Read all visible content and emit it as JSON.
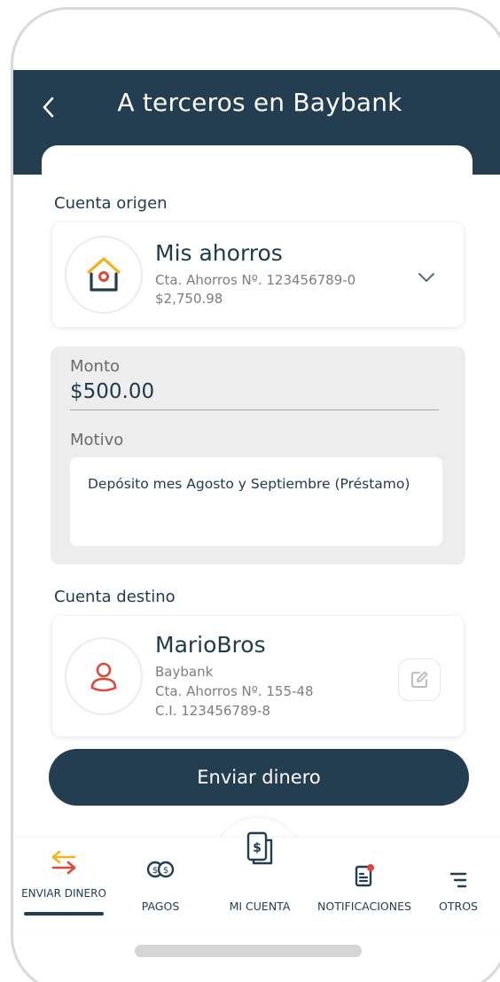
{
  "header": {
    "title": "A terceros en Baybank"
  },
  "origin": {
    "section_label": "Cuenta origen",
    "name": "Mis ahorros",
    "account": "Cta. Ahorros Nº. 123456789-0",
    "balance": "$2,750.98"
  },
  "form": {
    "amount_label": "Monto",
    "amount_value": "$500.00",
    "reason_label": "Motivo",
    "reason_value": "Depósito mes Agosto y Septiembre (Préstamo)"
  },
  "destination": {
    "section_label": "Cuenta destino",
    "name": "MarioBros",
    "bank": "Baybank",
    "account": "Cta. Ahorros Nº. 155-48",
    "id": "C.I. 123456789-8"
  },
  "actions": {
    "send_label": "Enviar dinero"
  },
  "tabs": [
    {
      "label": "ENVIAR DINERO",
      "icon": "transfer-icon",
      "active": true
    },
    {
      "label": "PAGOS",
      "icon": "coins-icon"
    },
    {
      "label": "MI CUENTA",
      "icon": "wallet-icon"
    },
    {
      "label": "NOTIFICACIONES",
      "icon": "notifications-icon",
      "badge": true
    },
    {
      "label": "OTROS",
      "icon": "menu-icon"
    }
  ],
  "colors": {
    "primary": "#233e50",
    "accent_yellow": "#f2b31f",
    "accent_red": "#e0463a",
    "background_panel": "#ededed"
  }
}
